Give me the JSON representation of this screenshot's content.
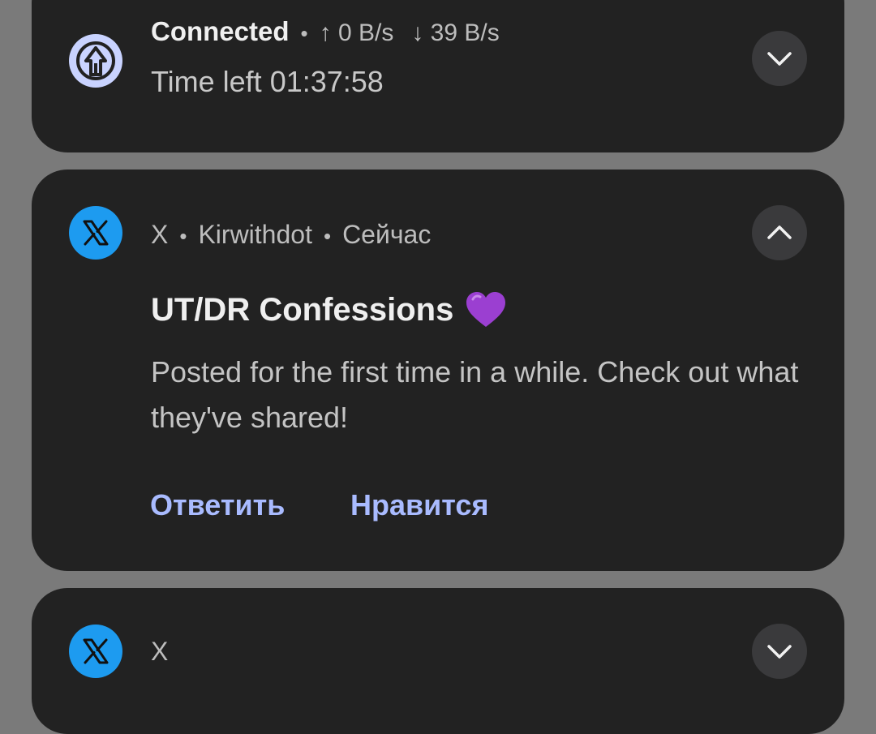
{
  "vpn_notification": {
    "status": "Connected",
    "upload": "↑ 0 B/s",
    "download": "↓ 39 B/s",
    "time_left": "Time left 01:37:58"
  },
  "x_notification": {
    "app_name": "X",
    "account": "Kirwithdot",
    "time": "Сейчас",
    "title": "UT/DR Confessions",
    "body": "Posted for the first time in a while. Check out what they've shared!",
    "actions": {
      "reply": "Ответить",
      "like": "Нравится"
    }
  },
  "x_notification_2": {
    "app_name": "X"
  },
  "separator": "•",
  "colors": {
    "background": "#7a7a7a",
    "card": "#222222",
    "accent_action": "#a9bbff",
    "x_brand": "#1d9bf0",
    "vpn_icon_bg": "#c9d3ff",
    "heart": "#9b3fd1"
  },
  "icons": {
    "vpn": "vpn-shield-arrow-icon",
    "x": "x-logo-icon",
    "heart": "purple-heart-icon",
    "chevron_down": "chevron-down-icon",
    "chevron_up": "chevron-up-icon"
  }
}
